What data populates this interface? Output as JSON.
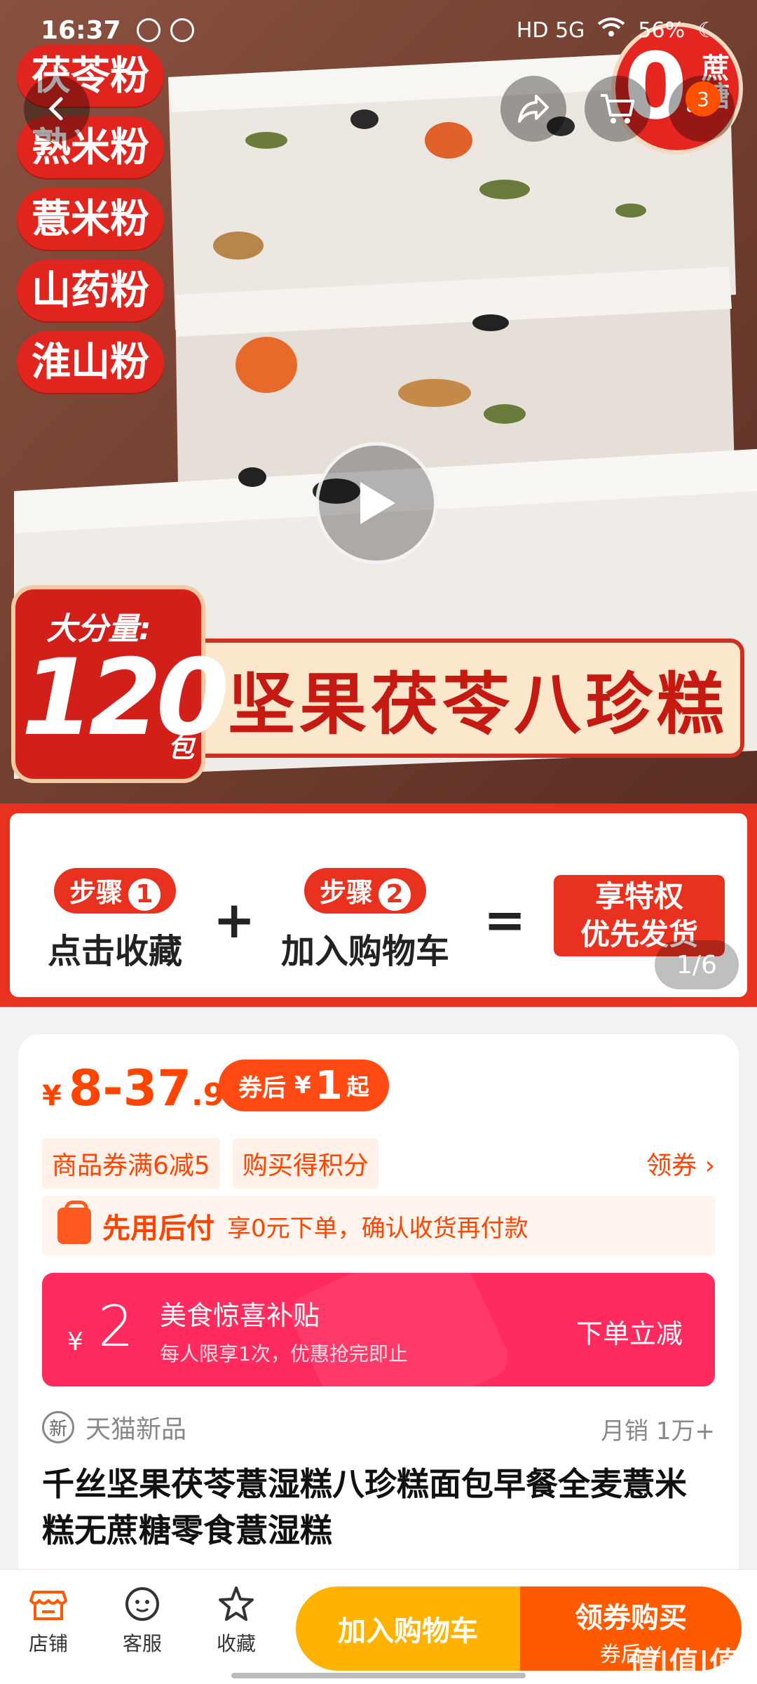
{
  "status_bar": {
    "time": "16:37",
    "net": "HD 5G",
    "battery": "56%"
  },
  "hero": {
    "side_labels": [
      "茯苓粉",
      "熟米粉",
      "薏米粉",
      "山药粉",
      "淮山粉"
    ],
    "zero_badge": {
      "zero": "0",
      "text": "蔗糖"
    },
    "cart_count": "3",
    "banner": {
      "small": "大分量:",
      "big": "120",
      "unit": "包",
      "title": "坚果茯苓八珍糕"
    },
    "page_indicator": "1/6"
  },
  "steps": {
    "step1": {
      "pill": "步骤",
      "num": "1",
      "text": "点击收藏"
    },
    "plus": "+",
    "step2": {
      "pill": "步骤",
      "num": "2",
      "text": "加入购物车"
    },
    "equals": "=",
    "privilege": [
      "享特权",
      "优先发货"
    ]
  },
  "product": {
    "price": {
      "currency": "¥",
      "range": "8-37",
      "decimal": ".99"
    },
    "after_coupon": {
      "label": "券后",
      "currency": "¥",
      "amount": "1",
      "suffix": "起"
    },
    "coupon_tags": [
      "商品券满6减5",
      "购买得积分"
    ],
    "get_coupon": "领券 ›",
    "paylater": {
      "title": "先用后付",
      "desc": "享0元下单，确认收货再付款"
    },
    "subsidy": {
      "currency": "¥",
      "amount": "2",
      "title": "美食惊喜补贴",
      "desc": "每人限享1次，优惠抢完即止",
      "cta": "下单立减"
    },
    "new_badge": "新",
    "new_label": "天猫新品",
    "monthly_sales": "月销 1万+",
    "title": "千丝坚果茯苓薏湿糕八珍糕面包早餐全麦薏米糕无蔗糖零食薏湿糕"
  },
  "bottom_bar": {
    "store": "店铺",
    "service": "客服",
    "favorite": "收藏",
    "add_cart": "加入购物车",
    "buy": "领券购买",
    "buy_sub": "券后 ¥"
  },
  "watermark": "值|值|值",
  "colors": {
    "accent": "#ff4400",
    "red": "#e8311f",
    "pink": "#ff2a5e",
    "yellow": "#ffb300"
  }
}
